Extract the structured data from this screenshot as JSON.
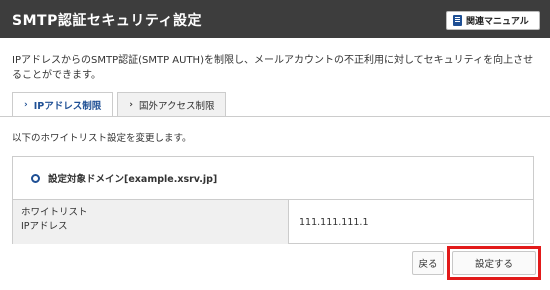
{
  "header": {
    "title": "SMTP認証セキュリティ設定",
    "manual_button_label": "関連マニュアル",
    "manual_icon": "book-icon"
  },
  "description": "IPアドレスからのSMTP認証(SMTP AUTH)を制限し、メールアカウントの不正利用に対してセキュリティを向上させることができます。",
  "tabs": [
    {
      "label": "IPアドレス制限",
      "active": true,
      "icon": "chevron-right-icon"
    },
    {
      "label": "国外アクセス制限",
      "active": false,
      "icon": "chevron-right-icon"
    }
  ],
  "instruction": "以下のホワイトリスト設定を変更します。",
  "panel": {
    "domain_label": "設定対象ドメイン[example.xsrv.jp]",
    "row": {
      "label_line1": "ホワイトリスト",
      "label_line2": "IPアドレス",
      "value": "111.111.111.1"
    }
  },
  "buttons": {
    "back_label": "戻る",
    "submit_label": "設定する"
  },
  "colors": {
    "header_bg": "#3d3d3d",
    "accent": "#1e4f94",
    "highlight": "#e21a1a"
  }
}
